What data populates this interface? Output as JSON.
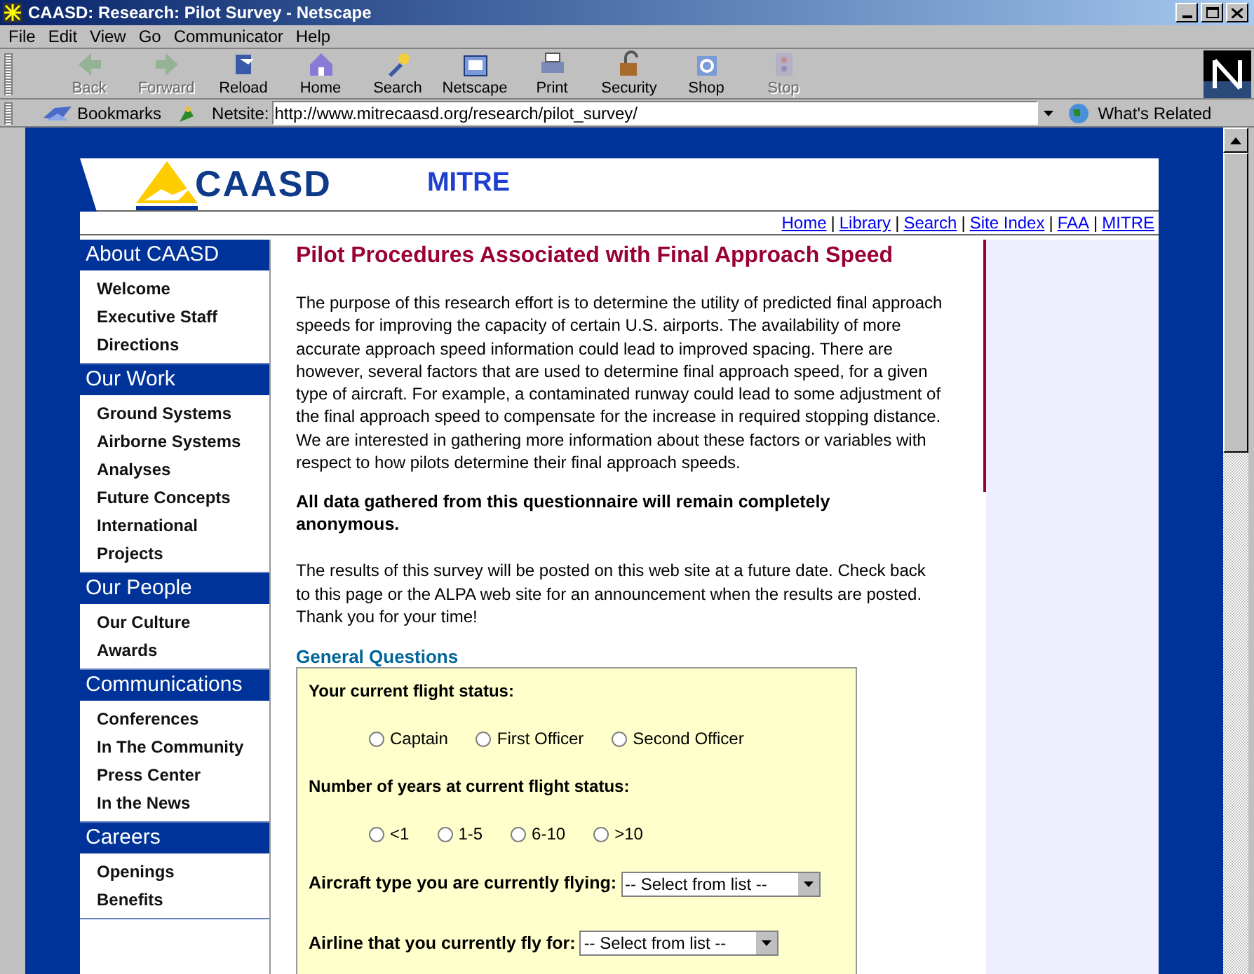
{
  "window": {
    "title": "CAASD: Research: Pilot Survey - Netscape"
  },
  "menu": [
    "File",
    "Edit",
    "View",
    "Go",
    "Communicator",
    "Help"
  ],
  "toolbar": [
    {
      "label": "Back",
      "disabled": true,
      "kind": "back"
    },
    {
      "label": "Forward",
      "disabled": true,
      "kind": "forward"
    },
    {
      "label": "Reload",
      "disabled": false,
      "kind": "reload"
    },
    {
      "label": "Home",
      "disabled": false,
      "kind": "home"
    },
    {
      "label": "Search",
      "disabled": false,
      "kind": "search"
    },
    {
      "label": "Netscape",
      "disabled": false,
      "kind": "netscape"
    },
    {
      "label": "Print",
      "disabled": false,
      "kind": "print"
    },
    {
      "label": "Security",
      "disabled": false,
      "kind": "security"
    },
    {
      "label": "Shop",
      "disabled": false,
      "kind": "shop"
    },
    {
      "label": "Stop",
      "disabled": true,
      "kind": "stop"
    }
  ],
  "location_bar": {
    "bookmarks": "Bookmarks",
    "netsite_label": "Netsite:",
    "url": "http://www.mitrecaasd.org/research/pilot_survey/",
    "whats_related": "What's Related"
  },
  "page": {
    "logo": "CAASD",
    "mitre": "MITRE",
    "top_links": [
      {
        "label": "Home",
        "separator": "|"
      },
      {
        "label": "Library",
        "separator": "|"
      },
      {
        "label": "Search",
        "separator": "|"
      },
      {
        "label": "Site Index",
        "separator": "|"
      },
      {
        "label": "FAA",
        "separator": "|"
      },
      {
        "label": "MITRE"
      }
    ],
    "sidebar": [
      {
        "heading": "About CAASD",
        "items": [
          "Welcome",
          "Executive Staff",
          "Directions"
        ]
      },
      {
        "heading": "Our Work",
        "items": [
          "Ground Systems",
          "Airborne Systems",
          "Analyses",
          "Future Concepts",
          "International",
          "Projects"
        ]
      },
      {
        "heading": "Our People",
        "items": [
          "Our Culture",
          "Awards"
        ]
      },
      {
        "heading": "Communications",
        "items": [
          "Conferences",
          "In The Community",
          "Press Center",
          "In the News"
        ]
      },
      {
        "heading": "Careers",
        "items": [
          "Openings",
          "Benefits"
        ]
      }
    ],
    "title": "Pilot Procedures Associated with Final Approach Speed",
    "intro": "The purpose of this research effort is to determine the utility of predicted final approach speeds for improving the capacity of certain U.S. airports. The availability of more accurate approach speed information could lead to improved spacing. There are however, several factors that are used to determine final approach speed, for a given type of aircraft. For example, a contaminated runway could lead to some adjustment of the final approach speed to compensate for the increase in required stopping distance. We are interested in gathering more information about these factors or variables with respect to how pilots determine their final approach speeds.",
    "notice": "All data gathered from this questionnaire will remain completely anonymous.",
    "results": "The results of this survey will be posted on this web site at a future date. Check back to this page or the ALPA web site for an announcement when the results are posted. Thank you for your time!",
    "form_title": "General Questions",
    "questions": [
      {
        "kind": "radio",
        "label": "Your current flight status:",
        "options": [
          {
            "label": "Captain",
            "selected": false
          },
          {
            "label": "First Officer",
            "selected": false
          },
          {
            "label": "Second Officer",
            "selected": false
          }
        ]
      },
      {
        "kind": "radio",
        "label": "Number of years at current flight status:",
        "options": [
          {
            "label": "<1",
            "selected": false
          },
          {
            "label": "1-5",
            "selected": false
          },
          {
            "label": "6-10",
            "selected": false
          },
          {
            "label": ">10",
            "selected": false
          }
        ]
      },
      {
        "kind": "select",
        "label": "Aircraft type you are currently flying:",
        "value": "-- Select from list --"
      },
      {
        "kind": "select",
        "label": "Airline that you currently fly for:",
        "value": "-- Select from list --"
      }
    ]
  }
}
